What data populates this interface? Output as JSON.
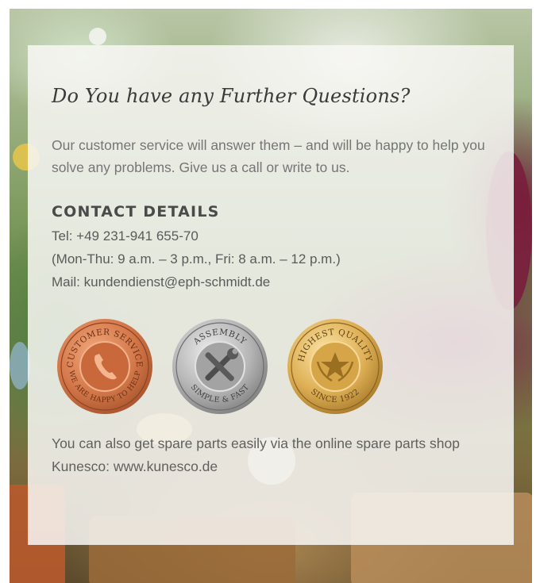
{
  "heading": "Do You have any Further Questions?",
  "intro": "Our customer service will answer them – and will be happy to help you solve any problems. Give us a call or write to us.",
  "contact": {
    "title": "CONTACT DETAILS",
    "tel": "Tel: +49 231-941 655-70",
    "hours": "(Mon-Thu: 9 a.m. – 3 p.m., Fri: 8 a.m. – 12 p.m.)",
    "mail": "Mail: kundendienst@eph-schmidt.de"
  },
  "badges": [
    {
      "top_text": "CUSTOMER SERVICE",
      "bottom_text": "WE ARE HAPPY TO HELP",
      "icon": "phone-icon",
      "color": "#c8693f"
    },
    {
      "top_text": "ASSEMBLY",
      "bottom_text": "SIMPLE & FAST",
      "icon": "wrench-screwdriver-icon",
      "color": "#a9a9a9"
    },
    {
      "top_text": "HIGHEST QUALITY",
      "bottom_text": "SINCE 1922",
      "icon": "star-laurel-icon",
      "color": "#d9ab4e"
    }
  ],
  "spare_parts": "You can also get spare parts easily via the online spare parts shop Kunesco: www.kunesco.de"
}
